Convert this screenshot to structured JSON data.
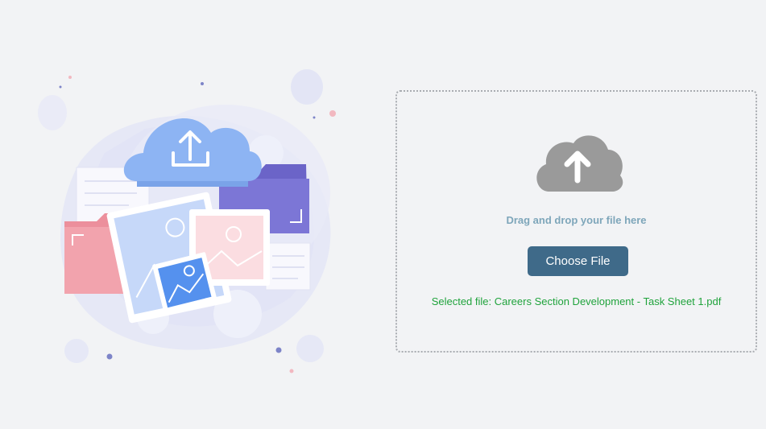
{
  "upload": {
    "drag_text": "Drag and drop your file here",
    "button_label": "Choose File",
    "selected_file_text": "Selected file: Careers Section Development - Task Sheet 1.pdf"
  },
  "icons": {
    "dropzone_icon": "cloud-upload-icon",
    "illustration": "file-upload-illustration"
  },
  "colors": {
    "background": "#f2f3f5",
    "button": "#3f6a89",
    "drag_text": "#7ea6ba",
    "selected_file": "#20a33c",
    "cloud_icon": "#9a9a9a"
  }
}
